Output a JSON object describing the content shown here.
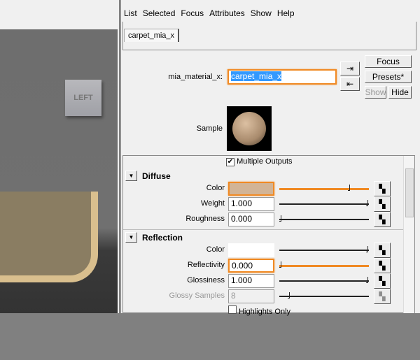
{
  "viewport": {
    "cube_label": "LEFT"
  },
  "menu": [
    "List",
    "Selected",
    "Focus",
    "Attributes",
    "Show",
    "Help"
  ],
  "tab": "carpet_mia_x",
  "node": {
    "label": "mia_material_x:",
    "value": "carpet_mia_x"
  },
  "buttons": {
    "focus": "Focus",
    "presets": "Presets*",
    "show": "Show",
    "hide": "Hide"
  },
  "sample_label": "Sample",
  "multiple_outputs": {
    "label": "Multiple Outputs",
    "checked": true
  },
  "sections": [
    {
      "title": "Diffuse",
      "rows": [
        {
          "label": "Color",
          "type": "color",
          "color": "#d2b496",
          "slider": 0.79
        },
        {
          "label": "Weight",
          "value": "1.000",
          "slider": 1.0
        },
        {
          "label": "Roughness",
          "value": "0.000",
          "slider": 0.0
        }
      ]
    },
    {
      "title": "Reflection",
      "rows": [
        {
          "label": "Color",
          "type": "color",
          "color": "#ffffff",
          "slider": 1.0
        },
        {
          "label": "Reflectivity",
          "value": "0.000",
          "slider": 0.0
        },
        {
          "label": "Glossiness",
          "value": "1.000",
          "slider": 1.0
        },
        {
          "label": "Glossy Samples",
          "value": "8",
          "slider": 0.1,
          "disabled": true
        }
      ],
      "highlights_only": {
        "label": "Highlights Only",
        "checked": false
      }
    }
  ],
  "colors": {
    "accent": "#f08a24",
    "selection": "#3399ff"
  }
}
